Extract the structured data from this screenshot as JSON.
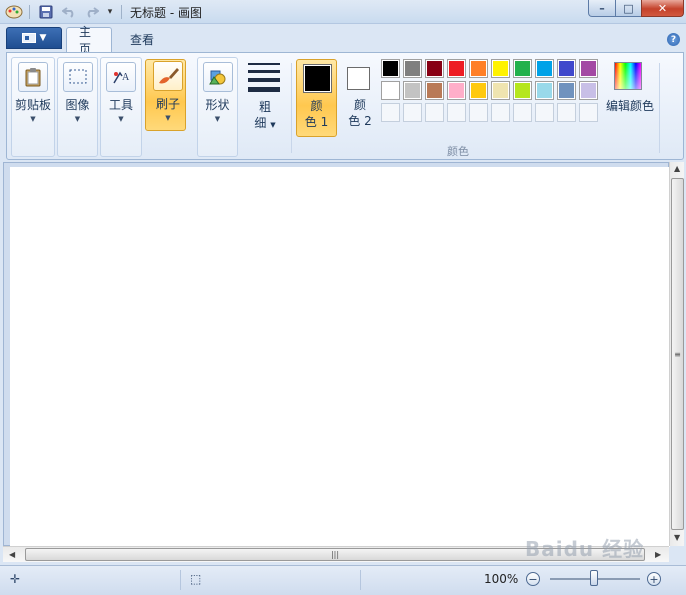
{
  "window": {
    "title": "无标题 - 画图",
    "controls": {
      "minimize": "–",
      "maximize": "□",
      "close": "✕"
    }
  },
  "quick_access": [
    "app-icon",
    "save-icon",
    "undo-icon",
    "redo-icon",
    "customize-menu-icon"
  ],
  "tabs": [
    {
      "label": "主页",
      "active": true
    },
    {
      "label": "查看",
      "active": false
    }
  ],
  "help": "?",
  "ribbon": {
    "clipboard": {
      "label": "剪贴板",
      "icon": "clipboard-icon"
    },
    "image": {
      "label": "图像",
      "icon": "select-rectangle-icon"
    },
    "tools": {
      "label": "工具",
      "icon": "tools-icon"
    },
    "brushes": {
      "label": "刷子",
      "icon": "brush-icon",
      "active": true
    },
    "shapes": {
      "label": "形状",
      "icon": "shapes-icon"
    },
    "size": {
      "label_line1": "粗",
      "label_line2": "细"
    },
    "color1": {
      "label_line1": "颜",
      "label_line2": "色 1",
      "color": "#000000"
    },
    "color2": {
      "label_line1": "颜",
      "label_line2": "色 2",
      "color": "#ffffff"
    },
    "edit_colors": {
      "label": "编辑颜色"
    },
    "colors_group_label": "颜色"
  },
  "palette": {
    "row1": [
      "#000000",
      "#7f7f7f",
      "#880015",
      "#ed1c24",
      "#ff7f27",
      "#fff200",
      "#22b14c",
      "#00a2e8",
      "#3f48cc",
      "#a349a4"
    ],
    "row2": [
      "#ffffff",
      "#c3c3c3",
      "#b97a57",
      "#ffaec9",
      "#ffc90e",
      "#efe4b0",
      "#b5e61d",
      "#99d9ea",
      "#7092be",
      "#c8bfe7"
    ],
    "row3_empty_count": 10
  },
  "status": {
    "zoom": "100%",
    "zoom_minus": "−",
    "zoom_plus": "+",
    "zoom_level": 1.0
  },
  "watermark": "Baidu 经验"
}
